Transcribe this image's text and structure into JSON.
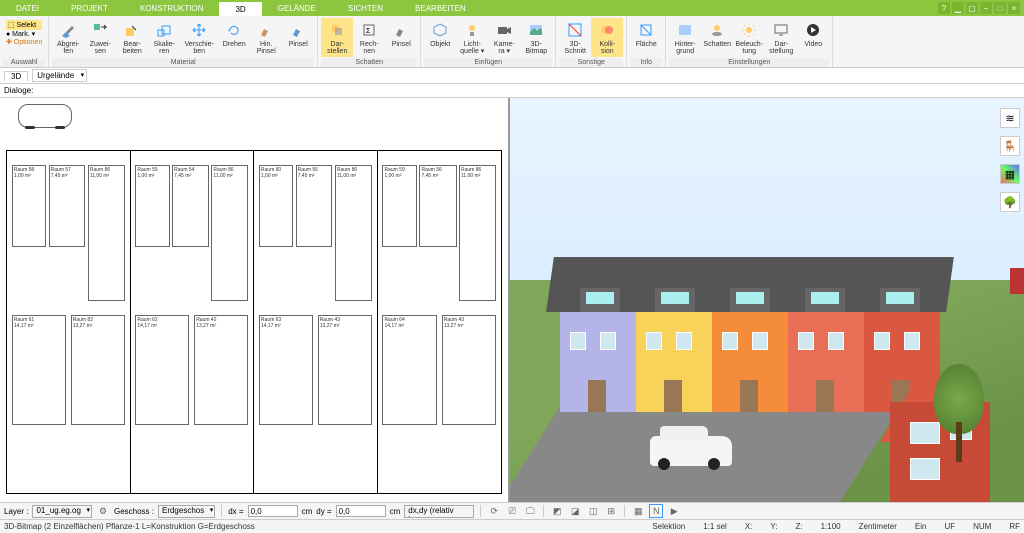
{
  "tabs": [
    "DATEI",
    "PROJEKT",
    "KONSTRUKTION",
    "3D",
    "GELÄNDE",
    "SICHTEN",
    "BEARBEITEN"
  ],
  "active_tab": 3,
  "selekt": {
    "a": "⬚ Selekt",
    "b": "● Mark. ▾",
    "c": "✚ Optionen"
  },
  "ribbon": {
    "auswahl_label": "Auswahl",
    "material": {
      "label": "Material",
      "items": [
        "Abgrei-\nfen",
        "Zuwei-\nsen",
        "Bear-\nbeiten",
        "Skalie-\nren",
        "Verschie-\nben",
        "Drehen",
        "Hin.\nPinsel",
        "Pinsel"
      ]
    },
    "schatten": {
      "label": "Schatten",
      "items": [
        "Dar-\nstellen",
        "Rech-\nnen",
        "Pinsel"
      ]
    },
    "einfuegen": {
      "label": "Einfügen",
      "items": [
        "Objekt",
        "Licht-\nquelle ▾",
        "Kame-\nra ▾",
        "3D-\nBitmap"
      ]
    },
    "sonstige": {
      "label": "Sonstige",
      "items": [
        "3D-\nSchnitt",
        "Kolli-\nsion"
      ]
    },
    "info": {
      "label": "Info",
      "items": [
        "Fläche"
      ]
    },
    "einstellungen": {
      "label": "Einstellungen",
      "items": [
        "Hinter-\ngrund",
        "Schatten",
        "Beleuch-\ntung",
        "Dar-\nstellung",
        "Video"
      ]
    }
  },
  "sec": {
    "tab": "3D",
    "dd": "Urgelände"
  },
  "dialoge": "Dialoge:",
  "floor": {
    "rooms_upper": [
      [
        "Raum 58",
        "1,00 m²"
      ],
      [
        "Raum 57",
        "7,45 m²"
      ],
      [
        "",
        "Raum 86",
        "11,00 m²"
      ],
      [
        "Raum 55",
        "1,00 m²"
      ],
      [
        "Raum 54",
        "7,45 m²"
      ],
      [
        "",
        "Raum 86",
        "11,00 m²"
      ],
      [
        "Raum 60",
        "1,00 m²"
      ],
      [
        "Raum 56",
        "7,45 m²"
      ],
      [
        "",
        "Raum 86",
        "11,00 m²"
      ],
      [
        "Raum 59",
        "1,00 m²"
      ],
      [
        "Raum 56",
        "7,45 m²"
      ],
      [
        "",
        "Raum 86",
        "11,00 m²"
      ]
    ],
    "rooms_lower": [
      [
        "Raum 61",
        "14,17 m²"
      ],
      [
        "Raum 82",
        "13,27 m²"
      ],
      [
        "Raum 62",
        "14,17 m²"
      ],
      [
        "Raum 42",
        "13,27 m²"
      ],
      [
        "Raum 63",
        "14,17 m²"
      ],
      [
        "Raum 43",
        "13,27 m²"
      ],
      [
        "Raum 64",
        "14,17 m²"
      ],
      [
        "Raum 43",
        "13,27 m²"
      ]
    ]
  },
  "bottom": {
    "layer": "Layer :",
    "layer_v": "01_ug.eg.og",
    "geschoss": "Geschoss :",
    "geschoss_v": "Erdgeschos",
    "dx": "dx =",
    "dy": "dy =",
    "cm": "cm",
    "val": "0,0",
    "mode": "dx,dy (relativ ka"
  },
  "status": {
    "left": "3D-Bitmap (2 Einzelflächen) Pflanze-1 L=Konstruktion G=Erdgeschoss",
    "sel": "Selektion",
    "scale": "1:1 sel",
    "x": "X:",
    "y": "Y:",
    "z": "Z:",
    "ratio": "1:100",
    "unit": "Zentimeter",
    "ein": "Ein",
    "uf": "UF",
    "num": "NUM",
    "rf": "RF"
  },
  "icons": {
    "layers": "≋",
    "chair": "🪑",
    "palette": "▦",
    "tree": "🌳"
  }
}
